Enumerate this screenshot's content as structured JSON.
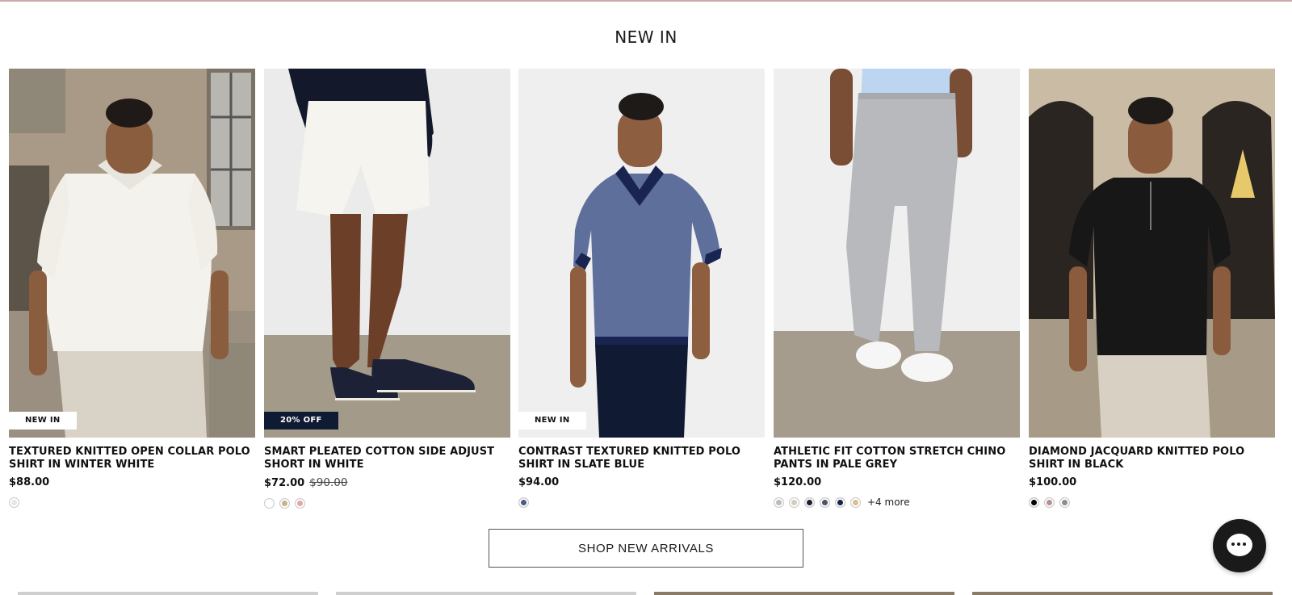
{
  "section": {
    "title": "NEW IN"
  },
  "products": [
    {
      "name": "TEXTURED KNITTED OPEN COLLAR POLO SHIRT IN WINTER WHITE",
      "price": "$88.00",
      "old_price": "",
      "badge": "NEW IN",
      "swatches": [
        "#e6e6e6"
      ],
      "more": ""
    },
    {
      "name": "SMART PLEATED COTTON SIDE ADJUST SHORT IN WHITE",
      "price": "$72.00",
      "old_price": "$90.00",
      "badge": "20% OFF",
      "swatches": [
        "#ffffff",
        "#c7b28a",
        "#e2a7a7"
      ],
      "more": ""
    },
    {
      "name": "CONTRAST TEXTURED KNITTED POLO SHIRT IN SLATE BLUE",
      "price": "$94.00",
      "old_price": "",
      "badge": "NEW IN",
      "swatches": [
        "#4a5b86"
      ],
      "more": ""
    },
    {
      "name": "ATHLETIC FIT COTTON STRETCH CHINO PANTS IN PALE GREY",
      "price": "$120.00",
      "old_price": "",
      "badge": "",
      "swatches": [
        "#b9bbbf",
        "#d4cdb8",
        "#1b1f2e",
        "#4e5569",
        "#1a2245",
        "#d8c08f"
      ],
      "more": "+4 more"
    },
    {
      "name": "DIAMOND JACQUARD KNITTED POLO SHIRT IN BLACK",
      "price": "$100.00",
      "old_price": "",
      "badge": "",
      "swatches": [
        "#000000",
        "#b59090",
        "#8a8d96"
      ],
      "more": ""
    }
  ],
  "cta": {
    "label": "SHOP NEW ARRIVALS"
  },
  "chat": {
    "icon": "chat-icon"
  }
}
